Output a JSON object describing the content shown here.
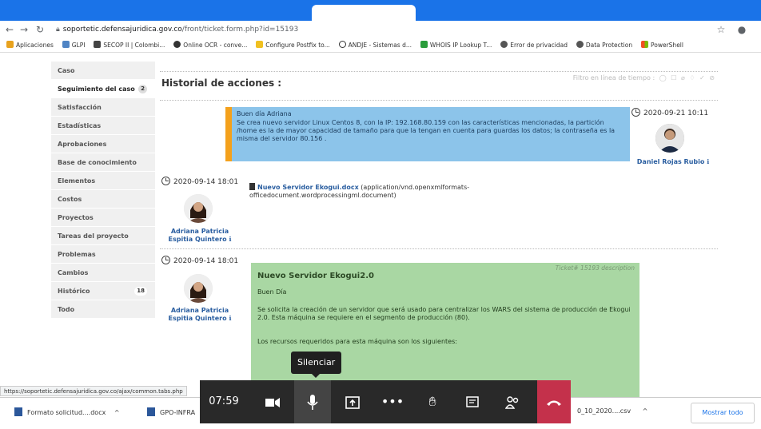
{
  "browser": {
    "url_domain": "soportetic.defensajuridica.gov.co",
    "url_path": "/front/ticket.form.php?id=15193",
    "bookmarks": [
      "Aplicaciones",
      "GLPI",
      "SECOP II | Colombi...",
      "Online OCR - conve...",
      "Configure Postfix to...",
      "ANDJE - Sistemas d...",
      "WHOIS IP Lookup T...",
      "Error de privacidad",
      "Data Protection",
      "PowerShell"
    ]
  },
  "sidebar": {
    "items": [
      {
        "label": "Caso"
      },
      {
        "label": "Seguimiento del caso",
        "count": "2"
      },
      {
        "label": "Satisfacción"
      },
      {
        "label": "Estadísticas"
      },
      {
        "label": "Aprobaciones"
      },
      {
        "label": "Base de conocimiento"
      },
      {
        "label": "Elementos"
      },
      {
        "label": "Costos"
      },
      {
        "label": "Proyectos"
      },
      {
        "label": "Tareas del proyecto"
      },
      {
        "label": "Problemas"
      },
      {
        "label": "Cambios"
      },
      {
        "label": "Histórico",
        "count": "18"
      },
      {
        "label": "Todo"
      }
    ]
  },
  "history": {
    "title": "Historial de acciones :",
    "filter_label": "Filtro en línea de tiempo :"
  },
  "followup": {
    "line1": "Buen día Adriana",
    "line2": "Se crea nuevo servidor Linux Centos 8, con la IP: 192.168.80.159  con las características mencionadas, la partición /home  es la de mayor capacidad de tamaño para que la tengan en cuenta para guardas los datos; la contraseña es la misma del servidor 80.156 .",
    "timestamp": "2020-09-21 10:11",
    "author": "Daniel Rojas Rubio"
  },
  "document": {
    "timestamp": "2020-09-14 18:01",
    "filename": "Nuevo Servidor Ekogui.docx",
    "mime": " (application/vnd.openxmlformats-officedocument.wordprocessingml.document)",
    "author": "Adriana Patricia Espitia Quintero"
  },
  "description": {
    "timestamp": "2020-09-14 18:01",
    "author": "Adriana Patricia Espitia Quintero",
    "header": "Ticket# 15193 description",
    "title": "Nuevo Servidor Ekogui2.0",
    "greeting": "Buen Día",
    "body1": "Se solicita la creación de un servidor que será usado para centralizar los WARS del sistema de producción de Ekogui 2.0. Esta máquina se requiere en el segmento de producción (80).",
    "body2": "Los recursos requeridos para esta máquina son los siguientes:"
  },
  "status_url": "https://soportetic.defensajuridica.gov.co/ajax/common.tabs.php",
  "downloads": {
    "item1": "Formato solicitud....docx",
    "item2": "GPO-INFRA",
    "item3": "0_10_2020....csv",
    "show_all": "Mostrar todo"
  },
  "call": {
    "time": "07:59",
    "tooltip": "Silenciar"
  },
  "colors": {
    "followup_bg": "#8cc4ea",
    "followup_accent": "#f4a11c",
    "description_bg": "#a9d7a3",
    "hangup": "#c4314b",
    "chrome_blue": "#1a73e8"
  }
}
